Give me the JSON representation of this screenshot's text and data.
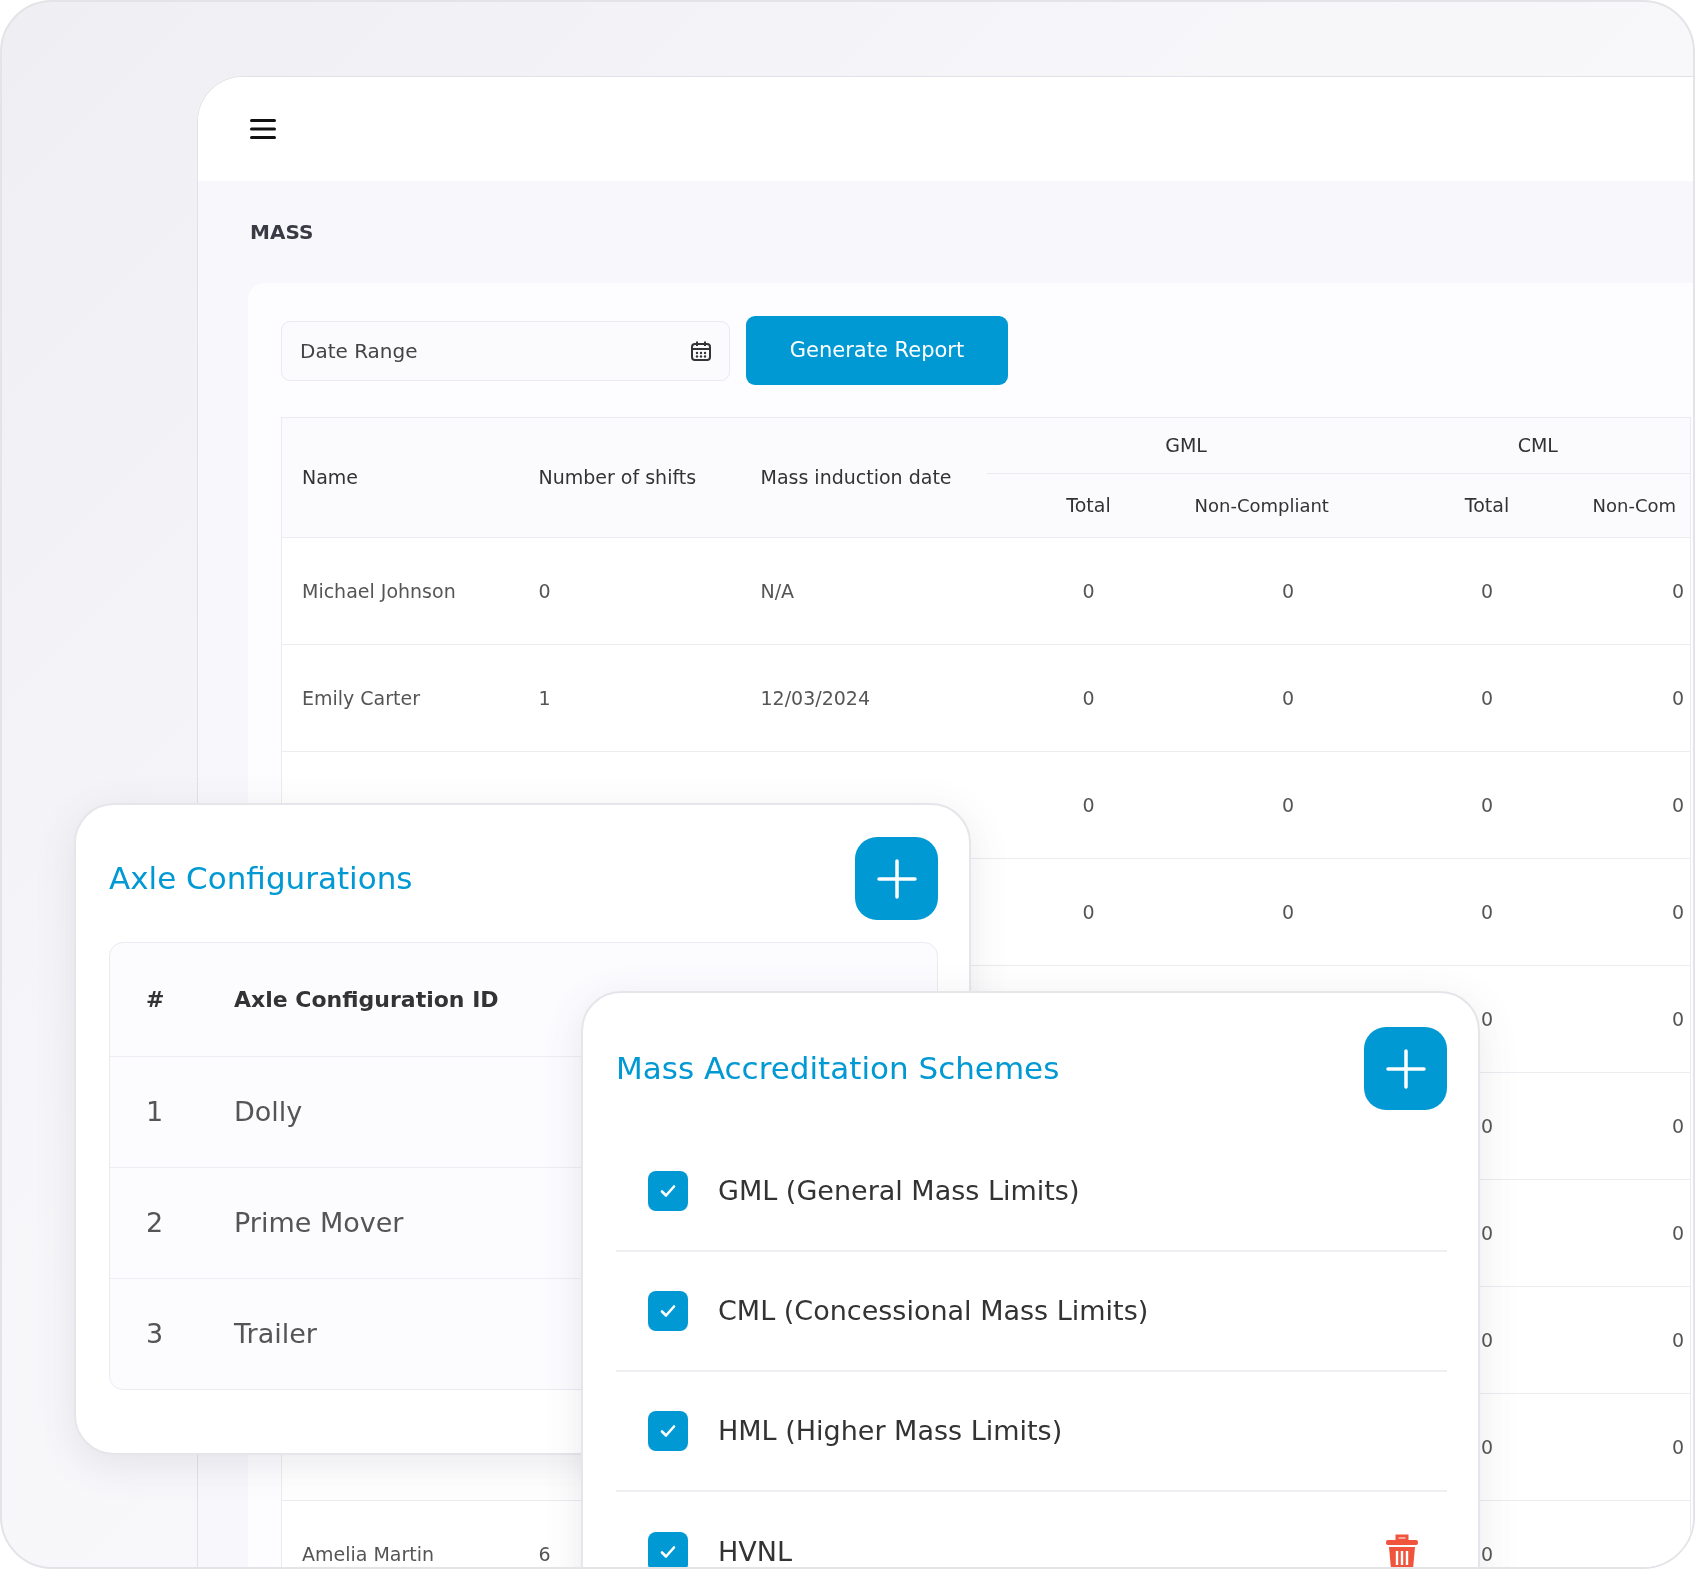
{
  "page_title": "MASS",
  "filters": {
    "date_range": {
      "placeholder": "Date Range"
    },
    "generate_button": "Generate Report"
  },
  "report_table": {
    "columns": [
      {
        "label": "Name"
      },
      {
        "label": "Number of shifts"
      },
      {
        "label": "Mass induction date"
      },
      {
        "label": "GML",
        "children": [
          "Total",
          "Non-Compliant"
        ]
      },
      {
        "label": "CML",
        "children": [
          "Total",
          "Non-Com"
        ]
      }
    ],
    "rows": [
      {
        "name": "Michael Johnson",
        "shifts": "0",
        "induction_date": "N/A",
        "gml_total": "0",
        "gml_non_compliant": "0",
        "cml_total": "0",
        "cml_non_compliant": "0"
      },
      {
        "name": "Emily Carter",
        "shifts": "1",
        "induction_date": "12/03/2024",
        "gml_total": "0",
        "gml_non_compliant": "0",
        "cml_total": "0",
        "cml_non_compliant": "0"
      },
      {
        "gml_total": "0",
        "gml_non_compliant": "0",
        "cml_total": "0",
        "cml_non_compliant": "0"
      },
      {
        "gml_total": "0",
        "gml_non_compliant": "0",
        "cml_total": "0",
        "cml_non_compliant": "0"
      },
      {
        "cml_total": "0",
        "cml_non_compliant": "0"
      },
      {
        "cml_total": "0",
        "cml_non_compliant": "0"
      },
      {
        "cml_total": "0",
        "cml_non_compliant": "0"
      },
      {
        "cml_total": "0",
        "cml_non_compliant": "0"
      },
      {
        "cml_total": "0",
        "cml_non_compliant": "0"
      },
      {
        "name": "Amelia Martin",
        "shifts": "6",
        "cml_total": "0"
      }
    ]
  },
  "axle_configurations": {
    "title": "Axle Configurations",
    "columns": [
      "#",
      "Axle Configuration ID"
    ],
    "rows": [
      {
        "number": "1",
        "name": "Dolly"
      },
      {
        "number": "2",
        "name": "Prime Mover"
      },
      {
        "number": "3",
        "name": "Trailer"
      }
    ]
  },
  "mass_accreditation_schemes": {
    "title": "Mass Accreditation Schemes",
    "items": [
      {
        "label": "GML (General Mass Limits)",
        "checked": true,
        "deletable": false
      },
      {
        "label": "CML (Concessional Mass Limits)",
        "checked": true,
        "deletable": false
      },
      {
        "label": "HML (Higher Mass Limits)",
        "checked": true,
        "deletable": false
      },
      {
        "label": "HVNL",
        "checked": true,
        "deletable": true
      }
    ]
  }
}
